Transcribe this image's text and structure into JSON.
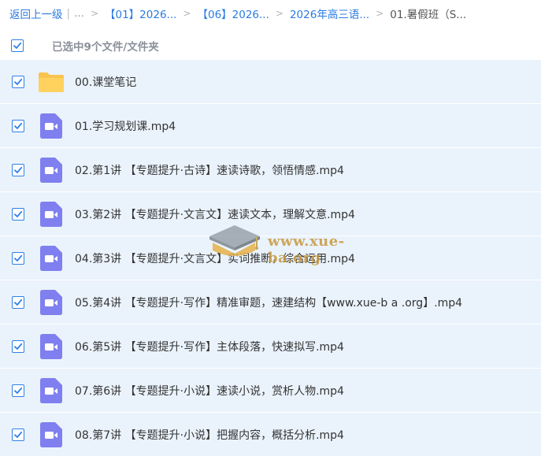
{
  "breadcrumb": {
    "back": "返回上一级",
    "separator": "|",
    "ellipsis": "...",
    "chevron": ">",
    "crumbs": [
      "【01】2026...",
      "【06】2026...",
      "2026年高三语..."
    ],
    "current": "01.暑假班（S..."
  },
  "selection": {
    "text": "已选中9个文件/文件夹"
  },
  "files": [
    {
      "name": "00.课堂笔记",
      "icon": "folder-icon"
    },
    {
      "name": "01.学习规划课.mp4",
      "icon": "video-icon"
    },
    {
      "name": "02.第1讲 【专题提升·古诗】速读诗歌，领悟情感.mp4",
      "icon": "video-icon"
    },
    {
      "name": "03.第2讲 【专题提升·文言文】速读文本，理解文意.mp4",
      "icon": "video-icon"
    },
    {
      "name": "04.第3讲 【专题提升·文言文】实词推断，综合运用.mp4",
      "icon": "video-icon"
    },
    {
      "name": "05.第4讲 【专题提升·写作】精准审题，速建结构【www.xue-b a .org】.mp4",
      "icon": "video-icon"
    },
    {
      "name": "06.第5讲 【专题提升·写作】主体段落，快速拟写.mp4",
      "icon": "video-icon"
    },
    {
      "name": "07.第6讲 【专题提升·小说】速读小说，赏析人物.mp4",
      "icon": "video-icon"
    },
    {
      "name": "08.第7讲 【专题提升·小说】把握内容，概括分析.mp4",
      "icon": "video-icon"
    }
  ],
  "watermark": {
    "text": "www.xue-ba.org"
  },
  "colors": {
    "link": "#2b7be2",
    "row_background": "#eaf3fc",
    "checkbox": "#2f80e8",
    "video_icon": "#7f7ff0",
    "folder_icon": "#f8c44f"
  }
}
